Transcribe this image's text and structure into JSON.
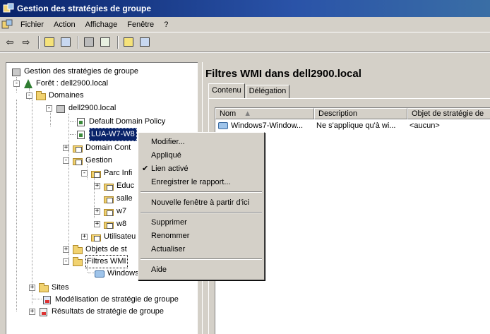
{
  "window": {
    "title": "Gestion des stratégies de groupe"
  },
  "menubar": {
    "items": [
      {
        "label": "Fichier"
      },
      {
        "label": "Action"
      },
      {
        "label": "Affichage"
      },
      {
        "label": "Fenêtre"
      },
      {
        "label": "?"
      }
    ]
  },
  "toolbar": {
    "buttons": [
      "back-icon",
      "forward-icon",
      "up-folder-icon",
      "show-hide-tree-icon",
      "delete-icon",
      "refresh-icon",
      "help-icon",
      "properties-icon"
    ]
  },
  "tree": {
    "root": "Gestion des stratégies de groupe",
    "forest": "Forêt : dell2900.local",
    "domains": "Domaines",
    "domain": "dell2900.local",
    "default_policy": "Default Domain Policy",
    "lua": "LUA-W7-W8",
    "domain_controllers": "Domain Cont",
    "gestion": "Gestion",
    "parc": "Parc Infi",
    "educ": "Educ",
    "salle": "salle",
    "w7": "w7",
    "w8": "w8",
    "utilisateurs": "Utilisateu",
    "objets": "Objets de st",
    "filtres": "Filtres WMI",
    "windows": "Windows",
    "sites": "Sites",
    "modelisation": "Modélisation de stratégie de groupe",
    "resultats": "Résultats de stratégie de groupe"
  },
  "main": {
    "title": "Filtres WMI dans dell2900.local",
    "tabs": [
      {
        "label": "Contenu"
      },
      {
        "label": "Délégation"
      }
    ],
    "columns": [
      "Nom",
      "Description",
      "Objet de stratégie de"
    ],
    "rows": [
      {
        "nom": "Windows7-Window...",
        "description": "Ne s'applique qu'à wi...",
        "objet": "<aucun>"
      }
    ]
  },
  "context_menu": {
    "items": [
      {
        "label": "Modifier..."
      },
      {
        "label": "Appliqué"
      },
      {
        "label": "Lien activé",
        "checked": true
      },
      {
        "label": "Enregistrer le rapport..."
      },
      {
        "label": "Nouvelle fenêtre à partir d'ici"
      },
      {
        "label": "Supprimer"
      },
      {
        "label": "Renommer"
      },
      {
        "label": "Actualiser"
      },
      {
        "label": "Aide"
      }
    ]
  },
  "colors": {
    "titlebar": "#0a246a",
    "selection": "#0a246a",
    "face": "#d4d0c8"
  }
}
